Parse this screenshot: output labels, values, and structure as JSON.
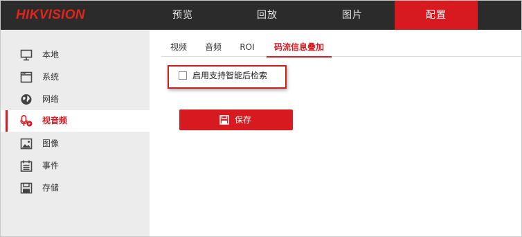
{
  "header": {
    "logo": "HIKVISION",
    "tabs": [
      {
        "label": "预览",
        "active": false
      },
      {
        "label": "回放",
        "active": false
      },
      {
        "label": "图片",
        "active": false
      },
      {
        "label": "配置",
        "active": true
      }
    ]
  },
  "sidebar": {
    "items": [
      {
        "label": "本地",
        "icon": "monitor-icon",
        "active": false
      },
      {
        "label": "系统",
        "icon": "window-icon",
        "active": false
      },
      {
        "label": "网络",
        "icon": "globe-icon",
        "active": false
      },
      {
        "label": "视音频",
        "icon": "mic-play-icon",
        "active": true
      },
      {
        "label": "图像",
        "icon": "image-icon",
        "active": false
      },
      {
        "label": "事件",
        "icon": "calendar-icon",
        "active": false
      },
      {
        "label": "存储",
        "icon": "disk-icon",
        "active": false
      }
    ]
  },
  "main": {
    "subtabs": [
      {
        "label": "视频",
        "active": false
      },
      {
        "label": "音频",
        "active": false
      },
      {
        "label": "ROI",
        "active": false
      },
      {
        "label": "码流信息叠加",
        "active": true
      }
    ],
    "checkbox": {
      "label": "启用支持智能后检索",
      "checked": false
    },
    "save_label": "保存"
  },
  "colors": {
    "accent": "#d71920",
    "topbar": "#2b2b2b",
    "sidebar": "#ececec"
  }
}
